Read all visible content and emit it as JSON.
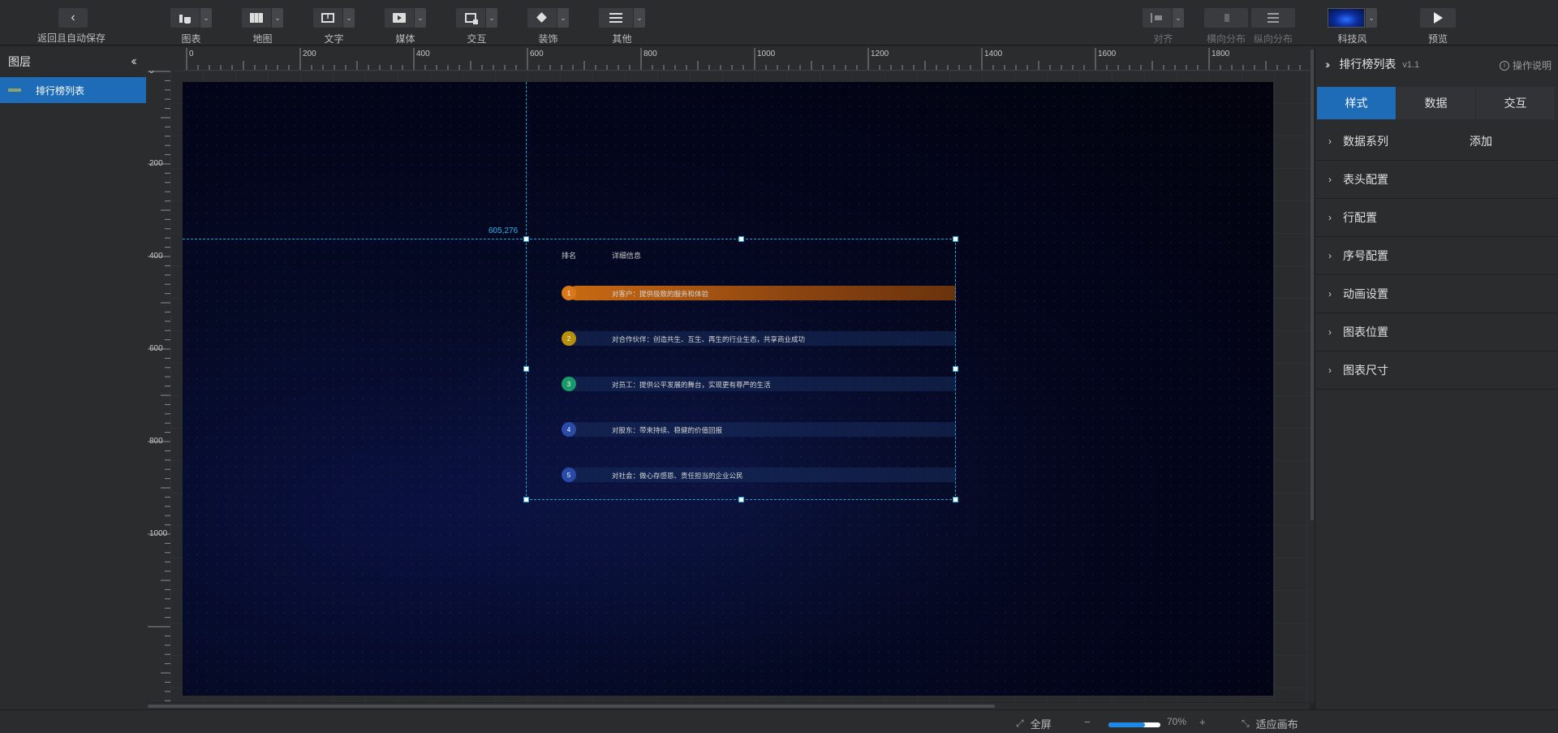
{
  "toolbar": {
    "back_label": "返回且自动保存",
    "items": [
      {
        "label": "图表",
        "icon": "bar-chart-icon"
      },
      {
        "label": "地图",
        "icon": "map-icon"
      },
      {
        "label": "文字",
        "icon": "text-icon"
      },
      {
        "label": "媒体",
        "icon": "media-icon"
      },
      {
        "label": "交互",
        "icon": "interaction-icon"
      },
      {
        "label": "装饰",
        "icon": "decoration-icon"
      },
      {
        "label": "其他",
        "icon": "other-icon"
      }
    ],
    "align_label": "对齐",
    "h_dist_label": "横向分布",
    "v_dist_label": "纵向分布",
    "theme_label": "科技风",
    "preview_label": "预览"
  },
  "layers": {
    "title": "图层",
    "items": [
      {
        "label": "排行榜列表",
        "selected": true
      }
    ]
  },
  "rulers": {
    "h_ticks": [
      "0",
      "200",
      "400",
      "600",
      "800",
      "1000",
      "1200",
      "1400",
      "1600",
      "1800"
    ],
    "v_ticks": [
      "0",
      "200",
      "400",
      "600",
      "800",
      "1000"
    ]
  },
  "canvas": {
    "coord_readout": "605,276"
  },
  "ranking": {
    "header": {
      "rank": "排名",
      "detail": "详细信息"
    },
    "rows": [
      {
        "no": "1",
        "text": "对客户：提供极致的服务和体验",
        "color": "#d9781a"
      },
      {
        "no": "2",
        "text": "对合作伙伴：创造共生、互生、再生的行业生态，共享商业成功",
        "color": "#b8900e"
      },
      {
        "no": "3",
        "text": "对员工：提供公平发展的舞台，实现更有尊严的生活",
        "color": "#1a9a6a"
      },
      {
        "no": "4",
        "text": "对股东：带来持续、稳健的价值回报",
        "color": "#2a4aa8"
      },
      {
        "no": "5",
        "text": "对社会：做心存感恩、责任担当的企业公民",
        "color": "#2a4aa8"
      }
    ]
  },
  "bottom": {
    "fullscreen": "全屏",
    "zoom": "70%",
    "fit": "适应画布"
  },
  "right_panel": {
    "title": "排行榜列表",
    "version": "v1.1",
    "help": "操作说明",
    "tabs": [
      "样式",
      "数据",
      "交互"
    ],
    "sections": [
      {
        "label": "数据系列",
        "extra": "添加"
      },
      {
        "label": "表头配置"
      },
      {
        "label": "行配置"
      },
      {
        "label": "序号配置"
      },
      {
        "label": "动画设置"
      },
      {
        "label": "图表位置"
      },
      {
        "label": "图表尺寸"
      }
    ]
  },
  "colors": {
    "accent": "#1e6bb8",
    "guide": "#1aa3d6"
  }
}
